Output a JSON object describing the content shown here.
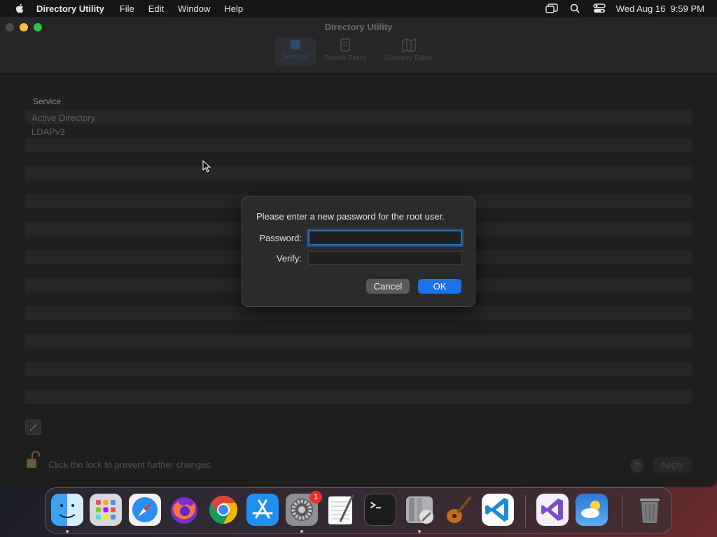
{
  "menubar": {
    "app_name": "Directory Utility",
    "menus": [
      "File",
      "Edit",
      "Window",
      "Help"
    ],
    "datetime": "Wed Aug 16  9:59 PM",
    "icons": [
      "screen-mirroring-icon",
      "spotlight-icon",
      "control-center-icon"
    ]
  },
  "window": {
    "title": "Directory Utility",
    "toolbar": {
      "tabs": [
        {
          "label": "Services",
          "icon": "services-icon",
          "selected": true
        },
        {
          "label": "Search Policy",
          "icon": "search-policy-icon",
          "selected": false
        },
        {
          "label": "Directory Editor",
          "icon": "directory-editor-icon",
          "selected": false
        }
      ]
    },
    "table": {
      "header": "Service",
      "rows": [
        "Active Directory",
        "LDAPv3"
      ]
    },
    "footer": {
      "lock_text": "Click the lock to prevent further changes.",
      "help_label": "?",
      "apply_label": "Apply"
    }
  },
  "dialog": {
    "message": "Please enter a new password for the root user.",
    "password_label": "Password:",
    "password_value": "",
    "verify_label": "Verify:",
    "verify_value": "",
    "cancel_label": "Cancel",
    "ok_label": "OK"
  },
  "dock": {
    "apps": [
      {
        "name": "Finder",
        "running": true
      },
      {
        "name": "Launchpad",
        "running": false
      },
      {
        "name": "Safari",
        "running": false
      },
      {
        "name": "Firefox",
        "running": false
      },
      {
        "name": "Chrome",
        "running": false
      },
      {
        "name": "App Store",
        "running": false
      },
      {
        "name": "System Settings",
        "running": true,
        "badge": "1"
      },
      {
        "name": "TextEdit",
        "running": false
      },
      {
        "name": "Terminal",
        "running": false
      },
      {
        "name": "Directory Utility",
        "running": true
      },
      {
        "name": "GarageBand",
        "running": false
      },
      {
        "name": "Visual Studio Code",
        "running": false
      },
      {
        "name": "Visual Studio",
        "running": false
      },
      {
        "name": "Weather",
        "running": false
      },
      {
        "name": "Trash",
        "running": false
      }
    ]
  },
  "colors": {
    "accent": "#1a73e8",
    "badge": "#e8322b",
    "focus_ring": "#2f6ea8"
  }
}
